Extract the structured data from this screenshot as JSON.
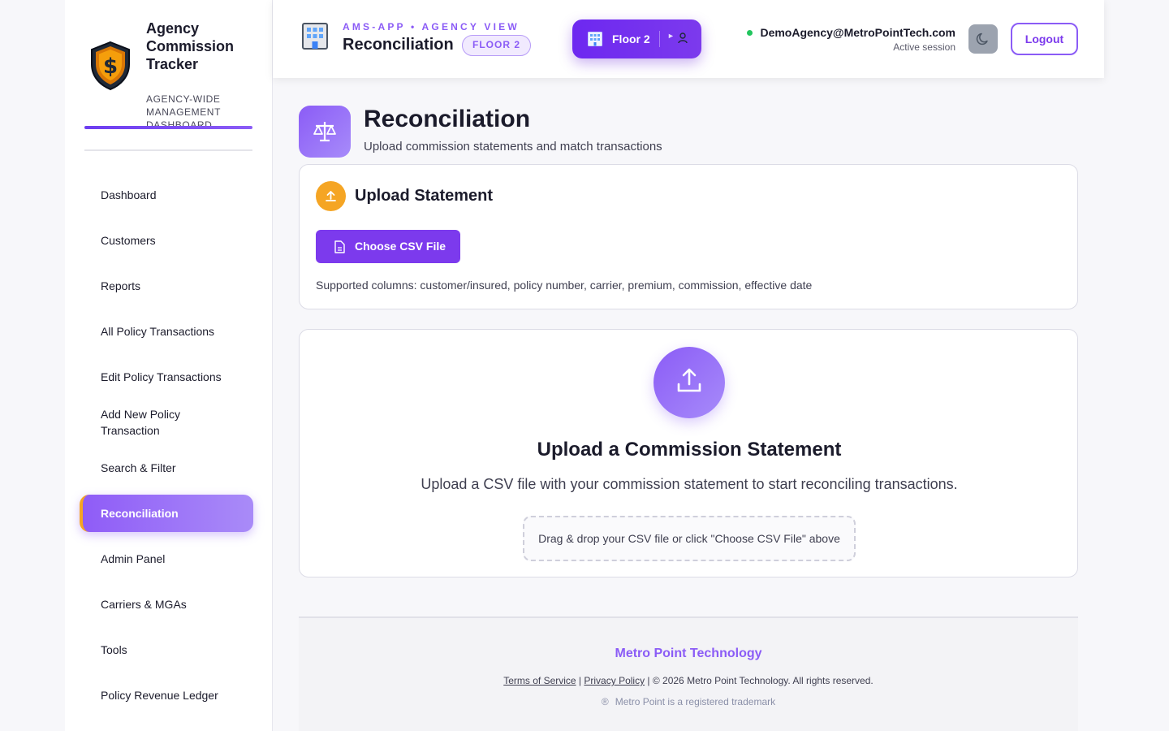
{
  "sidebar": {
    "brand_title": "Agency Commission Tracker",
    "brand_subtitle": "AGENCY-WIDE MANAGEMENT DASHBOARD",
    "items": [
      {
        "label": "Dashboard"
      },
      {
        "label": "Customers"
      },
      {
        "label": "Reports"
      },
      {
        "label": "All Policy Transactions"
      },
      {
        "label": "Edit Policy Transactions"
      },
      {
        "label": "Add New Policy Transaction"
      },
      {
        "label": "Search & Filter"
      },
      {
        "label": "Reconciliation",
        "active": true
      },
      {
        "label": "Admin Panel"
      },
      {
        "label": "Carriers & MGAs"
      },
      {
        "label": "Tools"
      },
      {
        "label": "Policy Revenue Ledger"
      }
    ]
  },
  "header": {
    "kicker": "AMS-APP • AGENCY VIEW",
    "title": "Reconciliation",
    "floor_pill": "FLOOR 2",
    "floor_button": "Floor 2",
    "user_email": "DemoAgency@MetroPointTech.com",
    "session_status": "Active session",
    "logout_label": "Logout",
    "status_color": "#22c55e"
  },
  "page": {
    "title": "Reconciliation",
    "subtitle": "Upload commission statements and match transactions"
  },
  "upload_card": {
    "title": "Upload Statement",
    "choose_button": "Choose CSV File",
    "supported": "Supported columns: customer/insured, policy number, carrier, premium, commission, effective date"
  },
  "empty_state": {
    "title": "Upload a Commission Statement",
    "description": "Upload a CSV file with your commission statement to start reconciling transactions.",
    "dropzone": "Drag & drop your CSV file or click \"Choose CSV File\" above"
  },
  "footer": {
    "brand": "Metro Point Technology",
    "terms": "Terms of Service",
    "sep1": " | ",
    "privacy": "Privacy Policy",
    "copyright": " | © 2026 Metro Point Technology. All rights reserved.",
    "trademark": "Metro Point is a registered trademark"
  },
  "colors": {
    "accent": "#7c3aed",
    "accent_light": "#8b5cf6",
    "warning": "#f5a524"
  }
}
